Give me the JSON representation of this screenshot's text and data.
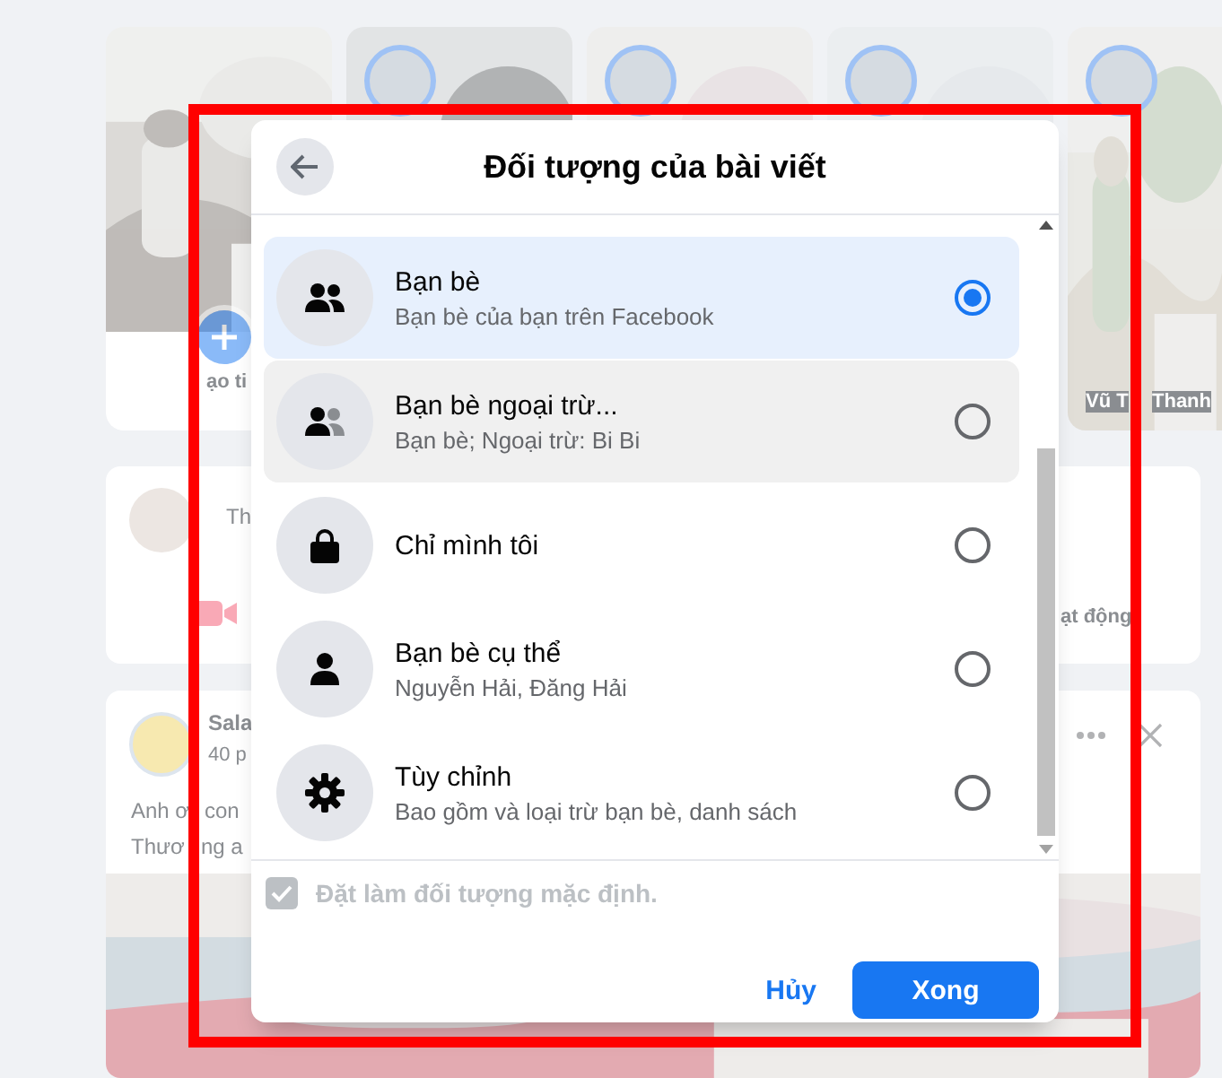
{
  "background": {
    "stories": [
      {
        "kind": "picture",
        "caption": "ạo ti"
      },
      {
        "kind": "picture"
      },
      {
        "kind": "picture"
      },
      {
        "kind": "picture"
      },
      {
        "kind": "picture",
        "caption": "Vũ T",
        "caption_2": "Thanh"
      }
    ],
    "composer": {
      "prompt": "Th",
      "action": "ạt động"
    },
    "post": {
      "author": "Sala",
      "time": "40 p",
      "lines": [
        [
          "Anh ơ",
          "con"
        ],
        [
          "Thươ",
          "ng a"
        ]
      ]
    }
  },
  "dialog": {
    "title": "Đối tượng của bài viết",
    "options": [
      {
        "kind": "friends",
        "title": "Bạn bè",
        "subtitle": "Bạn bè của bạn trên Facebook",
        "selected": true,
        "hovered": false
      },
      {
        "kind": "friends-except",
        "title": "Bạn bè ngoại trừ...",
        "subtitle": "Bạn bè; Ngoại trừ: Bi Bi",
        "selected": false,
        "hovered": true
      },
      {
        "kind": "lock",
        "title": "Chỉ mình tôi",
        "selected": false,
        "hovered": false
      },
      {
        "kind": "person",
        "title": "Bạn bè cụ thể",
        "subtitle": "Nguyễn Hải, Đăng Hải",
        "selected": false,
        "hovered": false
      },
      {
        "kind": "gear",
        "title": "Tùy chỉnh",
        "subtitle": "Bao gồm và loại trừ bạn bè, danh sách",
        "selected": false,
        "hovered": false
      }
    ],
    "default_checkbox": {
      "label": "Đặt làm đối tượng mặc định.",
      "checked": true,
      "disabled": true
    },
    "buttons": [
      {
        "kind": "cancel",
        "label": "Hủy"
      },
      {
        "kind": "done",
        "label": "Xong"
      }
    ]
  }
}
